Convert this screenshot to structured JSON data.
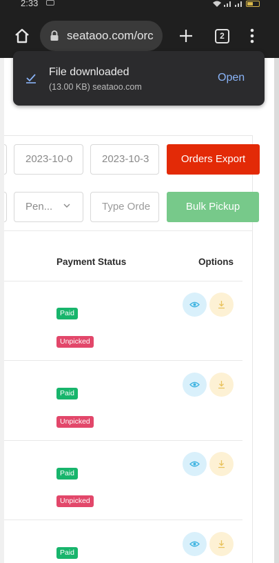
{
  "status_bar": {
    "time": "2:33"
  },
  "browser": {
    "url": "seataoo.com/orc",
    "tab_count": "2",
    "icons": [
      "home-icon",
      "lock-icon",
      "new-tab-plus-icon",
      "tab-switcher-icon",
      "overflow-menu-icon"
    ]
  },
  "toast": {
    "title": "File downloaded",
    "subtitle": "(13.00 KB) seataoo.com",
    "action": "Open"
  },
  "filters": {
    "date_from": "2023-10-0",
    "date_to": "2023-10-3",
    "status_selected": "Pen...",
    "order_placeholder": "Type Orde",
    "export_label": "Orders Export",
    "bulk_label": "Bulk Pickup"
  },
  "colors": {
    "export": "#e32a07",
    "bulk": "#77c98a",
    "paid": "#18b56c",
    "unpicked": "#e2476a",
    "view": "#d9f0fb",
    "download": "#fdf1d4"
  },
  "table": {
    "headers": {
      "payment_status": "Payment Status",
      "options": "Options"
    },
    "rows": [
      {
        "payment": "Paid",
        "pickup": "Unpicked"
      },
      {
        "payment": "Paid",
        "pickup": "Unpicked"
      },
      {
        "payment": "Paid",
        "pickup": "Unpicked"
      },
      {
        "payment": "Paid",
        "pickup": ""
      }
    ]
  }
}
